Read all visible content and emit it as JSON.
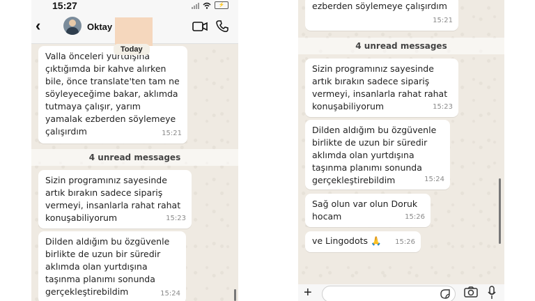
{
  "status": {
    "time": "15:27",
    "battery": "⚡"
  },
  "header": {
    "contact_name": "Oktay",
    "back_icon": "chevron-left-icon",
    "video_icon": "video-call-icon",
    "call_icon": "phone-icon"
  },
  "date_chip": "Today",
  "left_chat": {
    "msg1": {
      "text": "Valla önceleri yurtdışına çıktığımda bir kahve alırken bile, önce translate'ten tam ne söyleyeceğime bakar, aklımda tutmaya çalışır, yarım yamalak ezberden söylemeye çalışırdım",
      "time": "15:21"
    },
    "unread": "4 unread messages",
    "msg2": {
      "text": "Sizin programınız sayesinde artık bırakın sadece sipariş vermeyi, insanlarla rahat rahat konuşabiliyorum",
      "time": "15:23"
    },
    "msg3": {
      "text": "Dilden aldığım bu özgüvenle birlikte de uzun bir süredir aklımda olan yurtdışına taşınma planımı sonunda gerçekleştirebildim",
      "time": "15:24"
    }
  },
  "right_chat": {
    "msg1": {
      "text": "ezberden söylemeye çalışırdım",
      "time": "15:21"
    },
    "unread": "4 unread messages",
    "msg2": {
      "text": "Sizin programınız sayesinde artık bırakın sadece sipariş vermeyi, insanlarla rahat rahat konuşabiliyorum",
      "time": "15:23"
    },
    "msg3": {
      "text": "Dilden aldığım bu özgüvenle birlikte de uzun bir süredir aklımda olan yurtdışına taşınma planımı sonunda gerçekleştirebildim",
      "time": "15:24"
    },
    "msg4": {
      "text": "Sağ olun var olun Doruk hocam",
      "time": "15:26"
    },
    "msg5": {
      "text": "ve Lingodots 🙏",
      "time": "15:26"
    }
  },
  "input_bar": {
    "plus_label": "+",
    "icons": [
      "plus-icon",
      "sticker-icon",
      "camera-icon",
      "microphone-icon"
    ]
  }
}
